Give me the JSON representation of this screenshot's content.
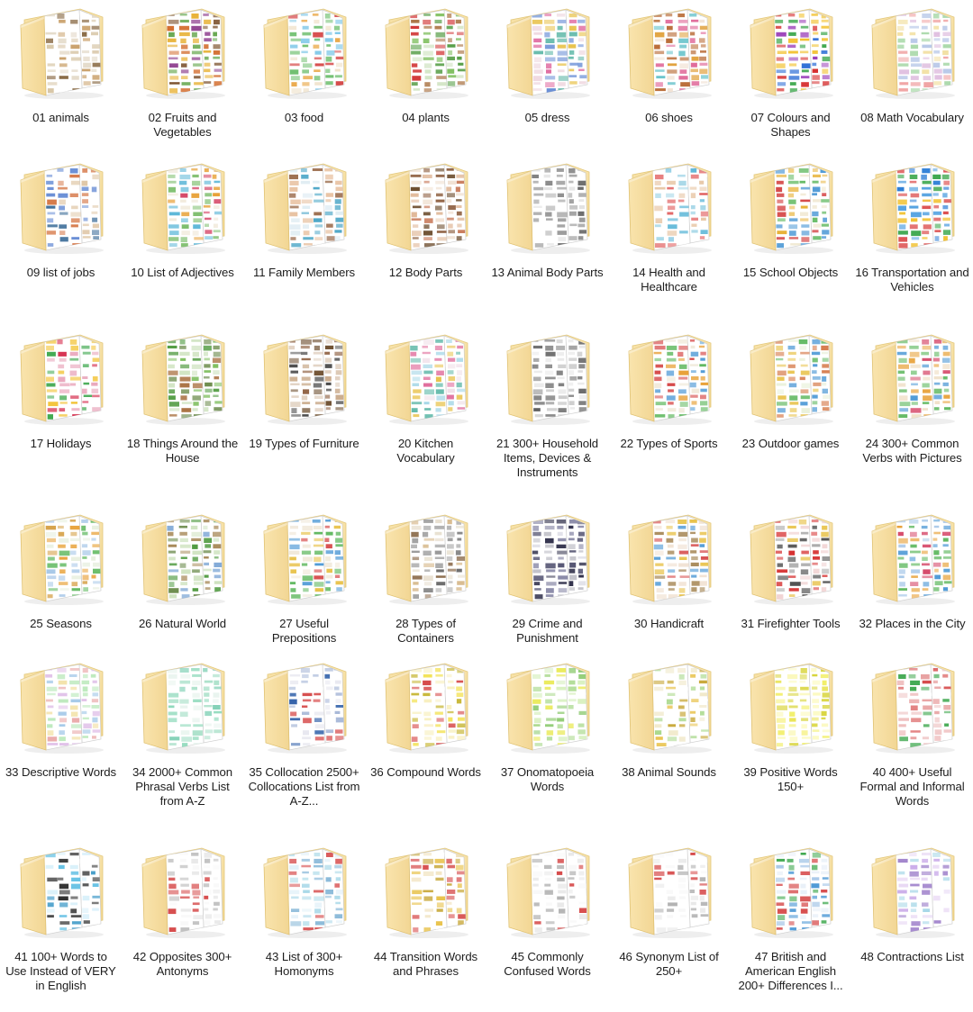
{
  "window": {
    "view": "large-icons-grid",
    "background": "#ffffff",
    "columns": 8,
    "rows": 6,
    "item_count": 48
  },
  "icon": {
    "type": "open-folder-with-documents",
    "folder_front_color": "#f7dfa2",
    "folder_back_color": "#f6d98f",
    "folder_edge_color": "#e8c979",
    "page_color": "#ffffff",
    "shadow_color": "#d9d9d9"
  },
  "folders": [
    {
      "index": "01",
      "label": "01 animals",
      "sheet_theme": "animals",
      "colors": [
        "#c9a06a",
        "#8a6b46",
        "#e3d9c8",
        "#ffffff",
        "#d8c7a8"
      ]
    },
    {
      "index": "02",
      "label": "02 Fruits and Vegetables",
      "sheet_theme": "fruits-vegetables",
      "colors": [
        "#5fa346",
        "#d26a2a",
        "#7a4f2a",
        "#8e3f8e",
        "#e8b33a"
      ]
    },
    {
      "index": "03",
      "label": "03 food",
      "sheet_theme": "food",
      "colors": [
        "#7fc8e8",
        "#e8a23a",
        "#d64a4a",
        "#6fbf6f",
        "#efe1c8"
      ]
    },
    {
      "index": "04",
      "label": "04 plants",
      "sheet_theme": "plants",
      "colors": [
        "#4f9a3f",
        "#d23a3a",
        "#7fbf5f",
        "#a86f3f",
        "#cfe3c0"
      ]
    },
    {
      "index": "05",
      "label": "05 dress",
      "sheet_theme": "dress",
      "colors": [
        "#e06aa0",
        "#6a8fd6",
        "#e8c24a",
        "#5fb8a8",
        "#efd8e0"
      ]
    },
    {
      "index": "06",
      "label": "06 shoes",
      "sheet_theme": "shoes",
      "colors": [
        "#b5632b",
        "#e0a03a",
        "#5fbfc8",
        "#e06a9a",
        "#f0dfd0"
      ]
    },
    {
      "index": "07",
      "label": "07 Colours and Shapes",
      "sheet_theme": "colours-shapes",
      "colors": [
        "#d62f2f",
        "#2f6fd6",
        "#f2c12f",
        "#3fa84f",
        "#9a3fb8"
      ]
    },
    {
      "index": "08",
      "label": "08 Math Vocabulary",
      "sheet_theme": "math-vocabulary",
      "colors": [
        "#f0a2a2",
        "#a8d8a8",
        "#f2e0a2",
        "#b8c8e8",
        "#e0c0e0"
      ]
    },
    {
      "index": "09",
      "label": "09 list of jobs",
      "sheet_theme": "jobs",
      "colors": [
        "#6a8fd6",
        "#d67a4a",
        "#3f6f9a",
        "#e0c8a8",
        "#ffffff"
      ]
    },
    {
      "index": "10",
      "label": "10 List of Adjectives",
      "sheet_theme": "adjectives",
      "colors": [
        "#5fb8d8",
        "#e8a23a",
        "#d64a6a",
        "#7fbf6f",
        "#f0e8d8"
      ]
    },
    {
      "index": "11",
      "label": "11 Family Members",
      "sheet_theme": "family-members",
      "colors": [
        "#4fa8c8",
        "#e8c2a2",
        "#9a6a4a",
        "#d8e8f0",
        "#ffffff"
      ]
    },
    {
      "index": "12",
      "label": "12 Body Parts",
      "sheet_theme": "body-parts",
      "colors": [
        "#8a5a3a",
        "#e0b898",
        "#c87a5a",
        "#f0e0d0",
        "#6a4a2a"
      ]
    },
    {
      "index": "13",
      "label": "13 Animal Body Parts",
      "sheet_theme": "animal-body-parts",
      "colors": [
        "#8a8a8a",
        "#b0b0b0",
        "#e0e0e0",
        "#6a6a6a",
        "#ffffff"
      ]
    },
    {
      "index": "14",
      "label": "14 Health and Healthcare",
      "sheet_theme": "health-healthcare",
      "colors": [
        "#5fb8d8",
        "#e05a5a",
        "#ffffff",
        "#a8d8e8",
        "#e8c8a8"
      ]
    },
    {
      "index": "15",
      "label": "15 School Objects",
      "sheet_theme": "school-objects",
      "colors": [
        "#e8b33a",
        "#4f9ad6",
        "#d64a4a",
        "#5fb85f",
        "#f0e8d0"
      ]
    },
    {
      "index": "16",
      "label": "16 Transportation and Vehicles",
      "sheet_theme": "transportation-vehicles",
      "colors": [
        "#2f7fd6",
        "#d62f2f",
        "#f2c12f",
        "#3fa84f",
        "#4f9fe0"
      ]
    },
    {
      "index": "17",
      "label": "17 Holidays",
      "sheet_theme": "holidays",
      "colors": [
        "#d62f4f",
        "#f2c12f",
        "#3fa84f",
        "#e8a2b8",
        "#ffffff"
      ]
    },
    {
      "index": "18",
      "label": "18 Things Around the House",
      "sheet_theme": "things-around-house",
      "colors": [
        "#4f9a3f",
        "#7fbf5f",
        "#a86f3f",
        "#cfe3c0",
        "#6a8a4a"
      ]
    },
    {
      "index": "19",
      "label": "19 Types of Furniture",
      "sheet_theme": "types-of-furniture",
      "colors": [
        "#8a5a3a",
        "#c8a888",
        "#4a4a4a",
        "#e0d0c0",
        "#6a4a2a"
      ]
    },
    {
      "index": "20",
      "label": "20 Kitchen Vocabulary",
      "sheet_theme": "kitchen-vocabulary",
      "colors": [
        "#e06a9a",
        "#5fb8a8",
        "#e8c24a",
        "#a8d8e8",
        "#f0e0e8"
      ]
    },
    {
      "index": "21",
      "label": "21 300+ Household Items, Devices & Instruments",
      "sheet_theme": "household-items",
      "colors": [
        "#4a4a4a",
        "#8a8a8a",
        "#c0c0c0",
        "#e8e8e8",
        "#6a6a6a"
      ]
    },
    {
      "index": "22",
      "label": "22 Types of Sports",
      "sheet_theme": "types-of-sports",
      "colors": [
        "#4f9ad6",
        "#e8a23a",
        "#5fb85f",
        "#d64a4a",
        "#f0e8d8"
      ]
    },
    {
      "index": "23",
      "label": "23 Outdoor games",
      "sheet_theme": "outdoor-games",
      "colors": [
        "#5fb85f",
        "#e8c24a",
        "#4f9ad6",
        "#d67a4a",
        "#e8f0d8"
      ]
    },
    {
      "index": "24",
      "label": "24 300+ Common Verbs with Pictures",
      "sheet_theme": "common-verbs",
      "colors": [
        "#e8a23a",
        "#4f9ad6",
        "#d64a6a",
        "#5fb85f",
        "#f0e0c8"
      ]
    },
    {
      "index": "25",
      "label": "25 Seasons",
      "sheet_theme": "seasons",
      "colors": [
        "#5fb85f",
        "#e8a23a",
        "#a8c8e8",
        "#d6a24a",
        "#e8f0e0"
      ]
    },
    {
      "index": "26",
      "label": "26 Natural World",
      "sheet_theme": "natural-world",
      "colors": [
        "#4f9a3f",
        "#7fa8d6",
        "#a88a5a",
        "#cfe3c0",
        "#6a8a4a"
      ]
    },
    {
      "index": "27",
      "label": "27 Useful Prepositions",
      "sheet_theme": "useful-prepositions",
      "colors": [
        "#e8c24a",
        "#4f9ad6",
        "#d64a4a",
        "#5fb85f",
        "#f0e8d8"
      ]
    },
    {
      "index": "28",
      "label": "28 Types of Containers",
      "sheet_theme": "types-of-containers",
      "colors": [
        "#a8a8a8",
        "#d6b88a",
        "#8a6a4a",
        "#e8e0d0",
        "#6a6a6a"
      ]
    },
    {
      "index": "29",
      "label": "29 Crime and Punishment",
      "sheet_theme": "crime-punishment",
      "colors": [
        "#4a4a6a",
        "#8a8aa8",
        "#c0c0c8",
        "#e0e0e8",
        "#2f2f4a"
      ]
    },
    {
      "index": "30",
      "label": "30 Handicraft",
      "sheet_theme": "handicraft",
      "colors": [
        "#d64a4a",
        "#e8c24a",
        "#4f9ad6",
        "#a88a5a",
        "#f0e0d0"
      ]
    },
    {
      "index": "31",
      "label": "31 Firefighter Tools",
      "sheet_theme": "firefighter-tools",
      "colors": [
        "#d62f2f",
        "#4a4a4a",
        "#e8c24a",
        "#a8a8a8",
        "#f0d0d0"
      ]
    },
    {
      "index": "32",
      "label": "32 Places in the City",
      "sheet_theme": "places-in-city",
      "colors": [
        "#4f9ad6",
        "#e8a23a",
        "#5fb85f",
        "#d64a6a",
        "#a8c8e8"
      ]
    },
    {
      "index": "33",
      "label": "33 Descriptive Words",
      "sheet_theme": "descriptive-words-table",
      "colors": [
        "#e8a2a2",
        "#a2c8e8",
        "#f2e0a2",
        "#b8e8b8",
        "#e0c0e8"
      ]
    },
    {
      "index": "34",
      "label": "34 2000+ Common Phrasal Verbs List from A-Z",
      "sheet_theme": "phrasal-verbs-table",
      "colors": [
        "#a8e0c8",
        "#ffffff",
        "#8ad8b8",
        "#e8f4ee",
        "#6ac8a8"
      ]
    },
    {
      "index": "35",
      "label": "35 Collocation 2500+ Collocations List from A-Z...",
      "sheet_theme": "collocations-table",
      "colors": [
        "#2f5fa8",
        "#e8e8f0",
        "#d64a4a",
        "#ffffff",
        "#a8b8d8"
      ]
    },
    {
      "index": "36",
      "label": "36 Compound Words",
      "sheet_theme": "compound-words-table",
      "colors": [
        "#f2e04a",
        "#ffffff",
        "#d64a4a",
        "#f8f0c0",
        "#c8b83a"
      ]
    },
    {
      "index": "37",
      "label": "37 Onomatopoeia Words",
      "sheet_theme": "onomatopoeia-table",
      "colors": [
        "#a8d88a",
        "#e8e84a",
        "#ffffff",
        "#d8f0c0",
        "#88c86a"
      ]
    },
    {
      "index": "38",
      "label": "38 Animal Sounds",
      "sheet_theme": "animal-sounds-table",
      "colors": [
        "#e8c24a",
        "#ffffff",
        "#a8d88a",
        "#f0e8c8",
        "#c8a83a"
      ]
    },
    {
      "index": "39",
      "label": "39 Positive Words 150+",
      "sheet_theme": "positive-words-table",
      "colors": [
        "#f2ef6a",
        "#f8f49a",
        "#e8e24a",
        "#fcfabf",
        "#d8d43a"
      ]
    },
    {
      "index": "40",
      "label": "40 400+ Useful Formal and Informal Words",
      "sheet_theme": "formal-informal-table",
      "colors": [
        "#e8a2a2",
        "#ffffff",
        "#3fa84f",
        "#d64a4a",
        "#f0c8c8"
      ]
    },
    {
      "index": "41",
      "label": "41 100+ Words to Use Instead of VERY in English",
      "sheet_theme": "very-alternatives-table",
      "colors": [
        "#4fb8e0",
        "#ffffff",
        "#2f2f2f",
        "#d8f0fa",
        "#3f9ac8"
      ]
    },
    {
      "index": "42",
      "label": "42 Opposites 300+ Antonyms",
      "sheet_theme": "antonyms-table",
      "colors": [
        "#ffffff",
        "#d64a4a",
        "#e8e8e8",
        "#f8f8f8",
        "#c0c0c0"
      ]
    },
    {
      "index": "43",
      "label": "43 List of 300+ Homonyms",
      "sheet_theme": "homonyms-table",
      "colors": [
        "#a8d8e8",
        "#ffffff",
        "#d64a4a",
        "#e0f0f8",
        "#88b8d8"
      ]
    },
    {
      "index": "44",
      "label": "44 Transition Words and Phrases",
      "sheet_theme": "transition-words-table",
      "colors": [
        "#e8c24a",
        "#d64a4a",
        "#ffffff",
        "#f0e0b8",
        "#c8a83a"
      ]
    },
    {
      "index": "45",
      "label": "45 Commonly Confused Words",
      "sheet_theme": "confused-words-table",
      "colors": [
        "#ffffff",
        "#d64a4a",
        "#e8e8e8",
        "#f8f8f8",
        "#b0b0b0"
      ]
    },
    {
      "index": "46",
      "label": "46 Synonym List of 250+",
      "sheet_theme": "synonyms-table",
      "colors": [
        "#ffffff",
        "#d64a4a",
        "#e8e8e8",
        "#f8f8f8",
        "#b0b0b0"
      ]
    },
    {
      "index": "47",
      "label": "47 British and American English 200+ Differences I...",
      "sheet_theme": "british-american-table",
      "colors": [
        "#4f9ad6",
        "#3fa84f",
        "#d64a4a",
        "#e8f0f8",
        "#a8c8e8"
      ]
    },
    {
      "index": "48",
      "label": "48 Contractions List",
      "sheet_theme": "contractions-table",
      "colors": [
        "#c8a8e8",
        "#a8d8e8",
        "#ffffff",
        "#e8d8f4",
        "#9a7ac8"
      ]
    }
  ]
}
